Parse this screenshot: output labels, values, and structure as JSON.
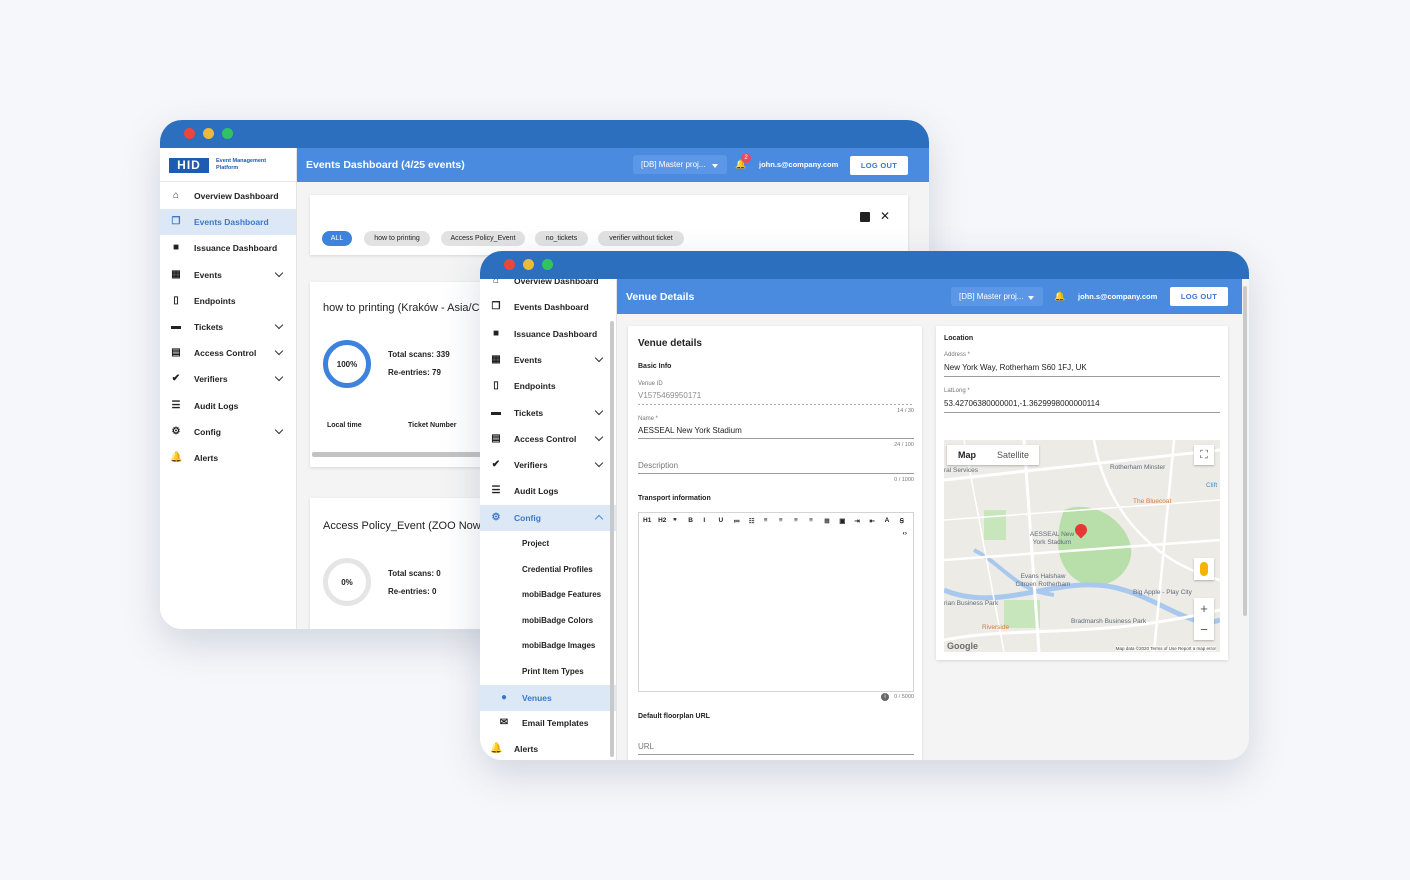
{
  "back": {
    "brand": {
      "logo": "HID",
      "line1": "Event Management",
      "line2": "Platform"
    },
    "header": {
      "title": "Events Dashboard (4/25 events)",
      "project": "[DB] Master proj...",
      "badge": "2",
      "user": "john.s@company.com",
      "logout": "LOG OUT"
    },
    "nav": [
      {
        "label": "Overview Dashboard",
        "icon": "home-icon",
        "glyph": "⌂"
      },
      {
        "label": "Events Dashboard",
        "icon": "dashboard-icon",
        "glyph": "❐"
      },
      {
        "label": "Issuance Dashboard",
        "icon": "issuance-icon",
        "glyph": "■"
      },
      {
        "label": "Events",
        "icon": "calendar-icon",
        "glyph": "▦"
      },
      {
        "label": "Endpoints",
        "icon": "phone-icon",
        "glyph": "▯"
      },
      {
        "label": "Tickets",
        "icon": "ticket-icon",
        "glyph": "▬"
      },
      {
        "label": "Access Control",
        "icon": "chart-icon",
        "glyph": "▤"
      },
      {
        "label": "Verifiers",
        "icon": "check-circle-icon",
        "glyph": "✔"
      },
      {
        "label": "Audit Logs",
        "icon": "list-icon",
        "glyph": "☰"
      },
      {
        "label": "Config",
        "icon": "gear-icon",
        "glyph": "⚙"
      },
      {
        "label": "Alerts",
        "icon": "bell-icon",
        "glyph": "🔔"
      }
    ],
    "filters": [
      "ALL",
      "how to printing",
      "Access Policy_Event",
      "no_tickets",
      "verifier without ticket"
    ],
    "event1": {
      "title": "how to printing (Kraków - Asia/C",
      "percent": "100%",
      "scans": "Total scans: 339",
      "reentries": "Re-entries: 79",
      "col1": "Local time",
      "col2": "Ticket Number"
    },
    "event2": {
      "title": "Access Policy_Event (ZOO Now",
      "percent": "0%",
      "scans": "Total scans: 0",
      "reentries": "Re-entries: 0"
    }
  },
  "front": {
    "header": {
      "title": "Venue Details",
      "project": "[DB] Master proj...",
      "user": "john.s@company.com",
      "logout": "LOG OUT"
    },
    "nav_top": [
      {
        "label": "Overview Dashboard",
        "icon": "home-icon",
        "glyph": "⌂"
      },
      {
        "label": "Events Dashboard",
        "icon": "dashboard-icon",
        "glyph": "❐"
      },
      {
        "label": "Issuance Dashboard",
        "icon": "issuance-icon",
        "glyph": "■"
      },
      {
        "label": "Events",
        "icon": "calendar-icon",
        "glyph": "▦"
      },
      {
        "label": "Endpoints",
        "icon": "phone-icon",
        "glyph": "▯"
      },
      {
        "label": "Tickets",
        "icon": "ticket-icon",
        "glyph": "▬"
      },
      {
        "label": "Access Control",
        "icon": "chart-icon",
        "glyph": "▤"
      },
      {
        "label": "Verifiers",
        "icon": "check-circle-icon",
        "glyph": "✔"
      },
      {
        "label": "Audit Logs",
        "icon": "list-icon",
        "glyph": "☰"
      },
      {
        "label": "Config",
        "icon": "gear-icon",
        "glyph": "⚙"
      }
    ],
    "config_sub": [
      "Project",
      "Credential Profiles",
      "mobiBadge Features",
      "mobiBadge Colors",
      "mobiBadge Images",
      "Print Item Types"
    ],
    "nav_bottom": [
      {
        "label": "Venues",
        "icon": "pin-icon",
        "glyph": "●"
      },
      {
        "label": "Email Templates",
        "icon": "mail-icon",
        "glyph": "✉"
      },
      {
        "label": "Alerts",
        "icon": "bell-icon",
        "glyph": "🔔"
      }
    ],
    "venue": {
      "heading": "Venue details",
      "basic_info": "Basic Info",
      "venue_id_label": "Venue ID",
      "venue_id": "V1575469950171",
      "venue_id_count": "14 / 30",
      "name_label": "Name *",
      "name": "AESSEAL New York Stadium",
      "name_count": "24 / 100",
      "description_placeholder": "Description",
      "description_count": "0 / 1000",
      "transport": "Transport information",
      "toolbar": [
        "H1",
        "H2",
        "❞",
        "B",
        "I",
        "U",
        "≔",
        "☷",
        "≡",
        "≡",
        "≡",
        "≡",
        "⊞",
        "▣",
        "⇥",
        "⇤",
        "A",
        "Ꞩ"
      ],
      "code_btn": "‹›",
      "editor_count": "0 / 5000",
      "floorplan": "Default floorplan URL",
      "url_placeholder": "URL"
    },
    "location": {
      "heading": "Location",
      "address_label": "Address *",
      "address": "New York Way, Rotherham S60 1FJ, UK",
      "latlong_label": "LatLong *",
      "latlong": "53.42706380000001,-1.3629998000000114",
      "map_tab": "Map",
      "satellite_tab": "Satellite",
      "labels": [
        "Rotherham Minster",
        "The Bluecoat",
        "AESSEAL New York Stadium",
        "Evans Halshaw Citroen Rotherham",
        "Big Apple - Play City",
        "Bradmarsh Business Park",
        "Riverside",
        "rian Business Park",
        "ral Services",
        "Clift"
      ],
      "google": "Google",
      "footer": "Map data ©2020   Terms of Use   Report a map error"
    }
  }
}
